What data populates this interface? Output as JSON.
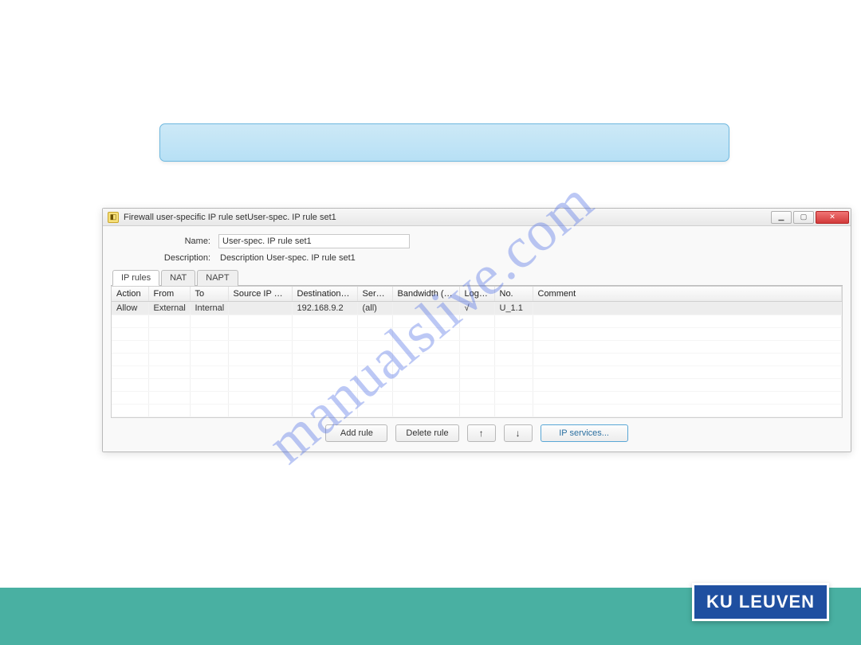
{
  "watermark": "manualslive.com",
  "footer_logo": "KU LEUVEN",
  "window": {
    "title": "Firewall user-specific IP rule setUser-spec. IP rule set1",
    "form": {
      "name_label": "Name:",
      "name_value": "User-spec. IP rule set1",
      "description_label": "Description:",
      "description_value": "Description User-spec. IP rule set1"
    },
    "tabs": {
      "ip_rules": "IP rules",
      "nat": "NAT",
      "napt": "NAPT"
    },
    "columns": {
      "action": "Action",
      "from": "From",
      "to": "To",
      "source_ip": "Source IP ad...",
      "dest_ip": "Destination I...",
      "servi": "Servi...",
      "bandwidth": "Bandwidth (M...",
      "loggi": "Loggi...",
      "no": "No.",
      "comment": "Comment"
    },
    "rows": [
      {
        "action": "Allow",
        "from": "External",
        "to": "Internal",
        "source_ip": "",
        "dest_ip": "192.168.9.2",
        "servi": "(all)",
        "bandwidth": "",
        "loggi": "√",
        "no": "U_1.1",
        "comment": ""
      }
    ],
    "buttons": {
      "add_rule": "Add rule",
      "delete_rule": "Delete rule",
      "ip_services": "IP services..."
    }
  }
}
